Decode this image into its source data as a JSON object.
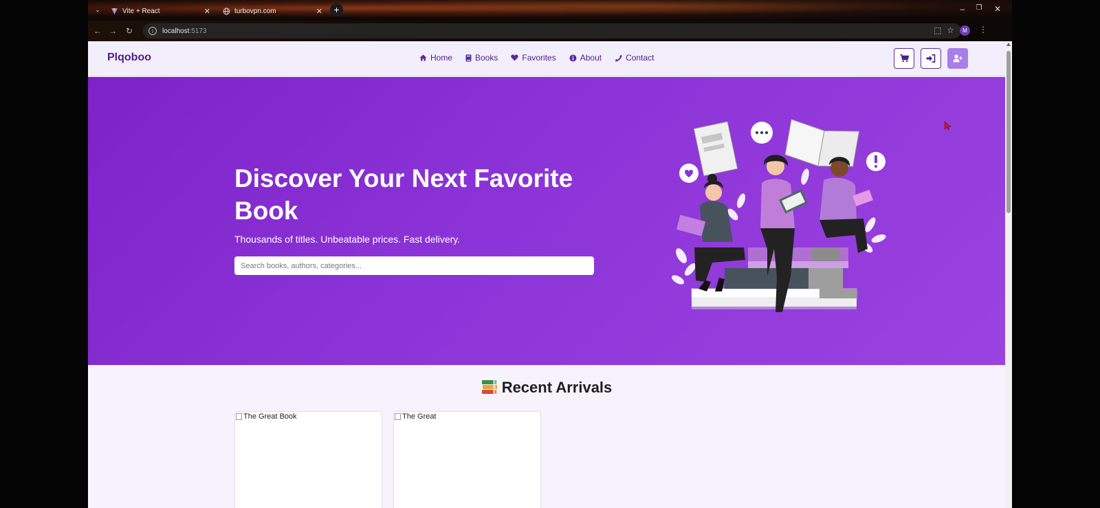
{
  "browser": {
    "tabs": [
      {
        "title": "Vite + React",
        "active": true
      },
      {
        "title": "turbovpn.com",
        "active": false
      }
    ],
    "url_host": "localhost",
    "url_port": ":5173",
    "profile_initial": "M"
  },
  "navbar": {
    "brand": "Plqoboo",
    "links": [
      {
        "label": "Home",
        "icon": "home-icon"
      },
      {
        "label": "Books",
        "icon": "book-icon"
      },
      {
        "label": "Favorites",
        "icon": "heart-icon"
      },
      {
        "label": "About",
        "icon": "info-icon"
      },
      {
        "label": "Contact",
        "icon": "phone-icon"
      }
    ],
    "action_icons": [
      "cart-icon",
      "sign-in-icon",
      "user-plus-icon"
    ]
  },
  "hero": {
    "title": "Discover Your Next Favorite Book",
    "subtitle": "Thousands of titles. Unbeatable prices. Fast delivery.",
    "search_placeholder": "Search books, authors, categories..."
  },
  "arrivals": {
    "heading": "Recent Arrivals",
    "books": [
      {
        "alt": "The Great Book"
      },
      {
        "alt": "The Great"
      }
    ]
  },
  "colors": {
    "brand": "#4b1f8a",
    "hero_start": "#7d22c9",
    "hero_end": "#9b43e0",
    "accent_button": "#a87ee8"
  }
}
